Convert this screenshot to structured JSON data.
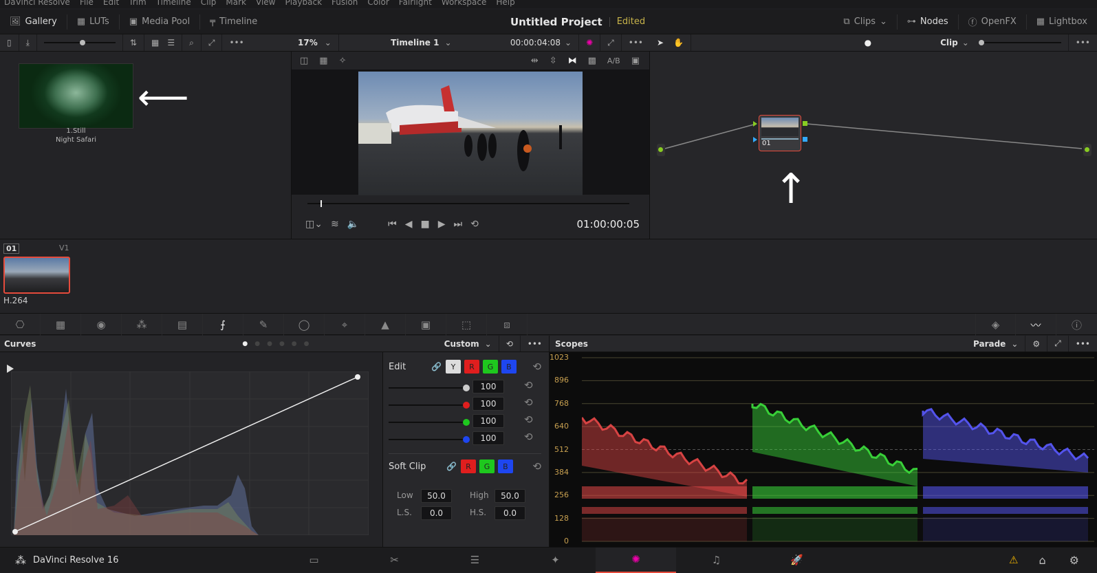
{
  "menu": [
    "DaVinci Resolve",
    "File",
    "Edit",
    "Trim",
    "Timeline",
    "Clip",
    "Mark",
    "View",
    "Playback",
    "Fusion",
    "Color",
    "Fairlight",
    "Workspace",
    "Help"
  ],
  "toolbar": {
    "gallery": "Gallery",
    "luts": "LUTs",
    "media_pool": "Media Pool",
    "timeline": "Timeline",
    "project_title": "Untitled Project",
    "project_status": "Edited",
    "clips": "Clips",
    "nodes": "Nodes",
    "openfx": "OpenFX",
    "lightbox": "Lightbox"
  },
  "viewer": {
    "zoom": "17%",
    "timeline_name": "Timeline 1",
    "duration": "00:00:04:08",
    "timecode": "01:00:00:05",
    "ab_label": "A/B",
    "playhead_fraction": 0.04
  },
  "gallery": {
    "still_label": "1.Still",
    "still_name": "Night Safari"
  },
  "nodes": {
    "mode": "Clip",
    "node_label": "01"
  },
  "timeline": {
    "clip_number": "01",
    "track": "V1",
    "codec": "H.264"
  },
  "curves": {
    "title": "Curves",
    "preset": "Custom"
  },
  "edit": {
    "label": "Edit",
    "channels": [
      "Y",
      "R",
      "G",
      "B"
    ],
    "values": [
      "100",
      "100",
      "100",
      "100"
    ],
    "soft_clip_label": "Soft Clip",
    "low_label": "Low",
    "low": "50.0",
    "high_label": "High",
    "high": "50.0",
    "ls_label": "L.S.",
    "ls": "0.0",
    "hs_label": "H.S.",
    "hs": "0.0"
  },
  "scopes": {
    "title": "Scopes",
    "mode": "Parade",
    "axis": [
      "1023",
      "896",
      "768",
      "640",
      "512",
      "384",
      "256",
      "128",
      "0"
    ]
  },
  "footer": {
    "app": "DaVinci Resolve 16"
  },
  "colors": {
    "accent": "#e64b3c",
    "edited": "#c8b44a",
    "red": "#e01e1e",
    "green": "#1ec81e",
    "blue": "#1e46f0"
  }
}
